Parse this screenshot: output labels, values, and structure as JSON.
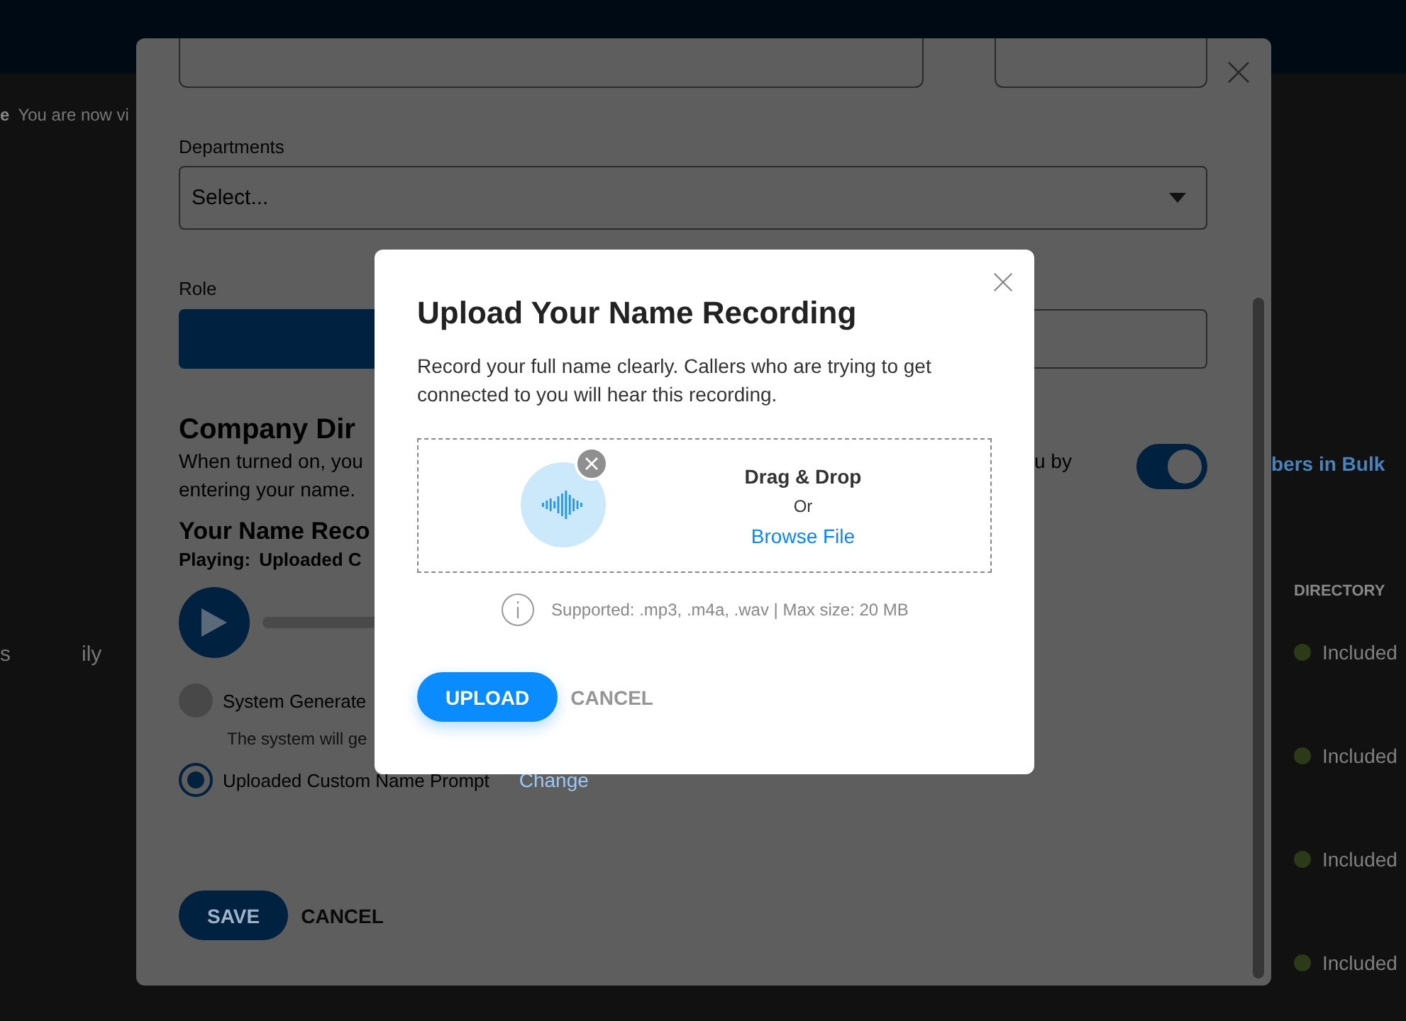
{
  "background_page": {
    "notice": [
      "e",
      "You are now vi"
    ],
    "row_fragments": [
      "s",
      "ily"
    ],
    "bulk_link": "bers in Bulk",
    "directory_header": "DIRECTORY",
    "directory_rows": [
      {
        "status": "Included"
      },
      {
        "status": "Included"
      },
      {
        "status": "Included"
      },
      {
        "status": "Included"
      }
    ]
  },
  "edit_modal": {
    "departments": {
      "label": "Departments",
      "placeholder": "Select..."
    },
    "role": {
      "label": "Role"
    },
    "company_directory": {
      "title": "Company Dir",
      "description_start": "When turned on, you",
      "description_end": "u by",
      "description_line2": "entering your name.",
      "on": true
    },
    "name_recording": {
      "title": "Your Name Reco",
      "playing_label": "Playing:",
      "playing_value": "Uploaded C"
    },
    "options": [
      {
        "label": "System Generate",
        "hint": "The system will ge",
        "selected": false
      },
      {
        "label": "Uploaded Custom Name Prompt",
        "action": "Change",
        "selected": true
      }
    ],
    "buttons": {
      "save": "SAVE",
      "cancel": "CANCEL"
    }
  },
  "upload_dialog": {
    "title": "Upload Your Name Recording",
    "description": "Record your full name clearly. Callers who are trying to get connected to you will hear this recording.",
    "drop_zone": {
      "heading": "Drag & Drop",
      "separator": "Or",
      "browse": "Browse File"
    },
    "supported": "Supported: .mp3, .m4a, .wav | Max size: 20 MB",
    "buttons": {
      "upload": "UPLOAD",
      "cancel": "CANCEL"
    }
  }
}
